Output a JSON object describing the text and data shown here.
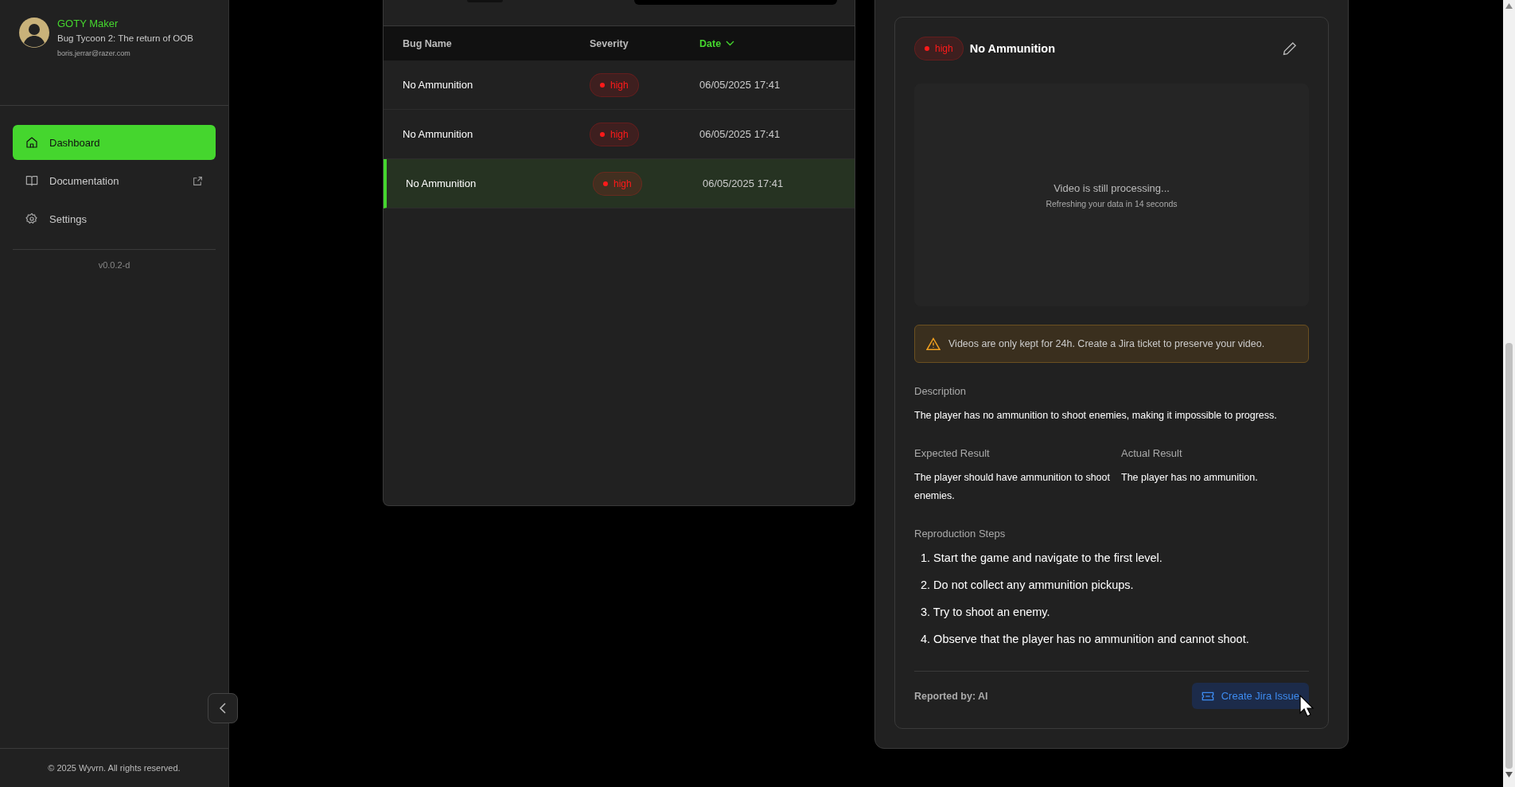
{
  "sidebar": {
    "user": {
      "name": "GOTY Maker",
      "project": "Bug Tycoon 2: The return of OOB",
      "email": "boris.jerrar@razer.com"
    },
    "nav": [
      {
        "label": "Dashboard",
        "kind": "home",
        "selected": true,
        "external": false
      },
      {
        "label": "Documentation",
        "kind": "book",
        "selected": false,
        "external": true
      },
      {
        "label": "Settings",
        "kind": "gear",
        "selected": false,
        "external": false
      }
    ],
    "version": "v0.0.2-d",
    "footer": "© 2025 Wyvrn. All rights reserved."
  },
  "table": {
    "columns": [
      {
        "label": "Bug Name",
        "sorted": false
      },
      {
        "label": "Severity",
        "sorted": false
      },
      {
        "label": "Date",
        "sorted": true
      }
    ],
    "rows": [
      {
        "name": "No Ammunition",
        "severity": "high",
        "date": "06/05/2025 17:41",
        "selected": false
      },
      {
        "name": "No Ammunition",
        "severity": "high",
        "date": "06/05/2025 17:41",
        "selected": false
      },
      {
        "name": "No Ammunition",
        "severity": "high",
        "date": "06/05/2025 17:41",
        "selected": true
      }
    ]
  },
  "detail": {
    "severity": "high",
    "title": "No Ammunition",
    "video": {
      "message": "Video is still processing...",
      "sub": "Refreshing your data in 14 seconds"
    },
    "warning": "Videos are only kept for 24h. Create a Jira ticket to preserve your video.",
    "description": {
      "label": "Description",
      "text": "The player has no ammunition to shoot enemies, making it impossible to progress."
    },
    "expected": {
      "label": "Expected Result",
      "text": "The player should have ammunition to shoot enemies."
    },
    "actual": {
      "label": "Actual Result",
      "text": "The player has no ammunition."
    },
    "steps": {
      "label": "Reproduction Steps",
      "items": [
        "1. Start the game and navigate to the first level.",
        "2. Do not collect any ammunition pickups.",
        "3. Try to shoot an enemy.",
        "4. Observe that the player has no ammunition and cannot shoot."
      ]
    },
    "reported_by": "Reported by: AI",
    "button": "Create Jira Issue"
  }
}
